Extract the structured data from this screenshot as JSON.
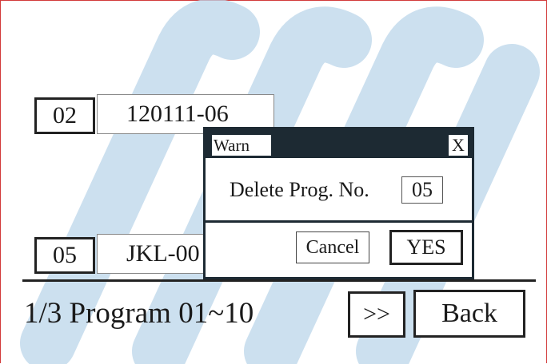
{
  "list": {
    "rows": [
      {
        "number": "02",
        "name": "120111-06"
      },
      {
        "number": "05",
        "name": "JKL-00"
      }
    ]
  },
  "footer": {
    "page_label": "1/3 Program 01~10",
    "next_label": ">>",
    "back_label": "Back"
  },
  "dialog": {
    "title": "Warn",
    "close_label": "X",
    "message": "Delete Prog. No.",
    "program_number": "05",
    "cancel_label": "Cancel",
    "yes_label": "YES"
  },
  "colors": {
    "frame": "#d23a3a",
    "watermark": "#bcd6ea",
    "dialog_bar": "#1d2a33"
  }
}
